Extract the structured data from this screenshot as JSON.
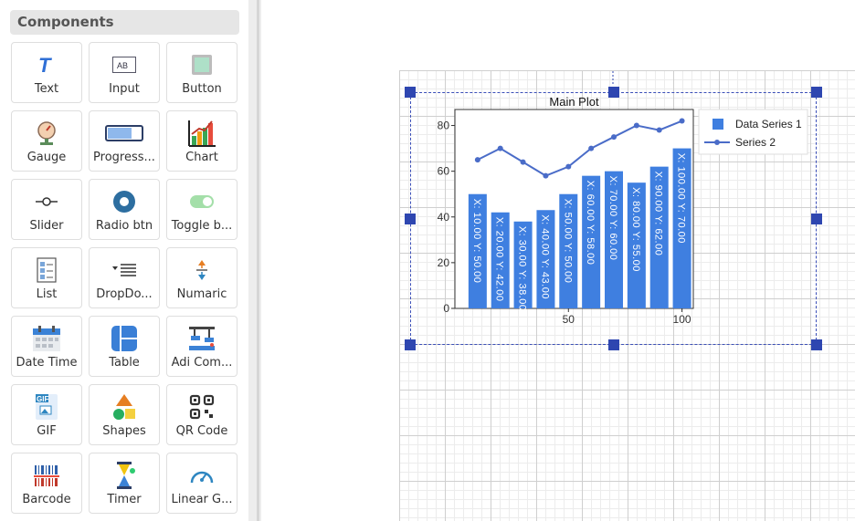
{
  "panel": {
    "title": "Components",
    "items": [
      {
        "label": "Text",
        "icon": "text-icon"
      },
      {
        "label": "Input",
        "icon": "input-icon"
      },
      {
        "label": "Button",
        "icon": "button-icon"
      },
      {
        "label": "Gauge",
        "icon": "gauge-icon"
      },
      {
        "label": "Progress...",
        "icon": "progress-icon"
      },
      {
        "label": "Chart",
        "icon": "chart-icon"
      },
      {
        "label": "Slider",
        "icon": "slider-icon"
      },
      {
        "label": "Radio btn",
        "icon": "radio-icon"
      },
      {
        "label": "Toggle b...",
        "icon": "toggle-icon"
      },
      {
        "label": "List",
        "icon": "list-icon"
      },
      {
        "label": "DropDo...",
        "icon": "dropdown-icon"
      },
      {
        "label": "Numaric",
        "icon": "numeric-icon"
      },
      {
        "label": "Date Time",
        "icon": "calendar-icon"
      },
      {
        "label": "Table",
        "icon": "table-icon"
      },
      {
        "label": "Adi Com...",
        "icon": "adi-component-icon"
      },
      {
        "label": "GIF",
        "icon": "gif-icon"
      },
      {
        "label": "Shapes",
        "icon": "shapes-icon"
      },
      {
        "label": "QR Code",
        "icon": "qr-code-icon"
      },
      {
        "label": "Barcode",
        "icon": "barcode-icon"
      },
      {
        "label": "Timer",
        "icon": "timer-icon"
      },
      {
        "label": "Linear G...",
        "icon": "linear-gauge-icon"
      }
    ]
  },
  "colors": {
    "bar": "#3f7fe0",
    "line": "#4a6cc8",
    "selection": "#2e46b0"
  },
  "chart_data": {
    "type": "bar",
    "title": "Main Plot",
    "xlabel": "",
    "ylabel": "",
    "xlim": [
      0,
      105
    ],
    "ylim": [
      0,
      87
    ],
    "x_ticks": [
      "50",
      "100"
    ],
    "y_ticks": [
      "0",
      "20",
      "40",
      "60",
      "80"
    ],
    "legend_position": "right",
    "series": [
      {
        "name": "Data Series 1",
        "kind": "bar",
        "x": [
          10,
          20,
          30,
          40,
          50,
          60,
          70,
          80,
          90,
          100
        ],
        "values": [
          50,
          42,
          38,
          43,
          50,
          58,
          60,
          55,
          62,
          70
        ],
        "labels": [
          "X: 10.00 Y: 50.00",
          "X: 20.00 Y: 42.00",
          "X: 30.00 Y: 38.00",
          "X: 40.00 Y: 43.00",
          "X: 50.00 Y: 50.00",
          "X: 60.00 Y: 58.00",
          "X: 70.00 Y: 60.00",
          "X: 80.00 Y: 55.00",
          "X: 90.00 Y: 62.00",
          "X: 100.00 Y: 70.00"
        ]
      },
      {
        "name": "Series 2",
        "kind": "line",
        "x": [
          10,
          20,
          30,
          40,
          50,
          60,
          70,
          80,
          90,
          100
        ],
        "values": [
          65,
          70,
          64,
          58,
          62,
          70,
          75,
          80,
          78,
          82
        ]
      }
    ]
  }
}
